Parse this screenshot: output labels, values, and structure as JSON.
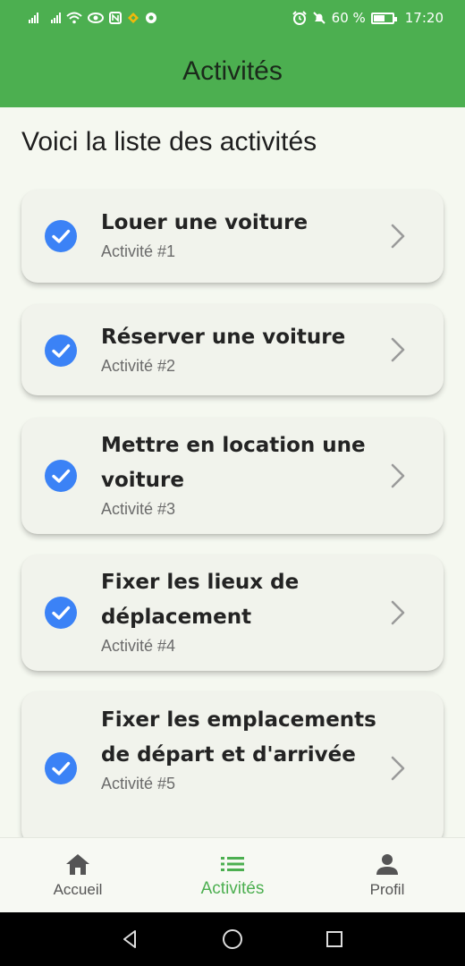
{
  "status_bar": {
    "battery_percent": "60 %",
    "battery_level": 0.6,
    "time": "17:20",
    "icons_left": [
      "signal-icon",
      "signal-icon",
      "wifi-icon",
      "eye-icon",
      "nfc-icon",
      "binance-icon",
      "shield-icon"
    ],
    "icons_right": [
      "alarm-icon",
      "mute-icon",
      "battery-icon"
    ]
  },
  "app_bar": {
    "title": "Activités"
  },
  "main": {
    "heading": "Voici la liste des activités",
    "activities": [
      {
        "title": "Louer une voiture",
        "subtitle": "Activité #1",
        "done": true
      },
      {
        "title": "Réserver une voiture",
        "subtitle": "Activité #2",
        "done": true
      },
      {
        "title": "Mettre en location une voiture",
        "subtitle": "Activité #3",
        "done": true
      },
      {
        "title": "Fixer les lieux de déplacement",
        "subtitle": "Activité #4",
        "done": true
      },
      {
        "title": "Fixer les emplacements de départ et d'arrivée",
        "subtitle": "Activité #5",
        "done": true
      }
    ]
  },
  "bottom_nav": {
    "items": [
      {
        "label": "Accueil",
        "icon": "home-icon",
        "active": false
      },
      {
        "label": "Activités",
        "icon": "list-icon",
        "active": true
      },
      {
        "label": "Profil",
        "icon": "person-icon",
        "active": false
      }
    ]
  },
  "colors": {
    "primary": "#4caf50",
    "check": "#3b82f6",
    "card": "#f1f3ec",
    "background": "#f5f8f0"
  }
}
